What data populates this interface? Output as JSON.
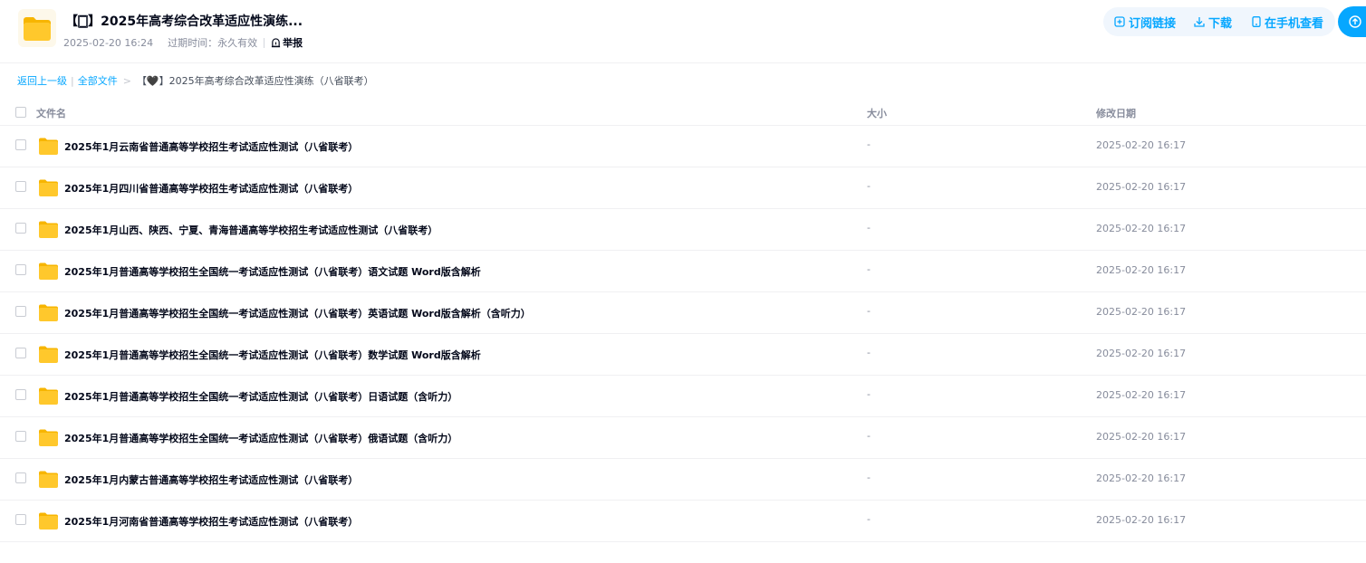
{
  "share": {
    "title": "【🀆】2025年高考综合改革适应性演练...",
    "date": "2025-02-20 16:24",
    "expire_label": "过期时间：",
    "expire_value": "永久有效",
    "report_label": "举报"
  },
  "actions": {
    "subscribe": "订阅链接",
    "download": "下载",
    "mobile": "在手机查看"
  },
  "breadcrumb": {
    "back": "返回上一级",
    "all_files": "全部文件",
    "arrow": ">",
    "current": "【🖤】2025年高考综合改革适应性演练（八省联考）"
  },
  "table": {
    "headers": {
      "name": "文件名",
      "size": "大小",
      "date": "修改日期"
    },
    "rows": [
      {
        "name": "2025年1月云南省普通高等学校招生考试适应性测试（八省联考）",
        "size": "-",
        "date": "2025-02-20 16:17"
      },
      {
        "name": "2025年1月四川省普通高等学校招生考试适应性测试（八省联考）",
        "size": "-",
        "date": "2025-02-20 16:17"
      },
      {
        "name": "2025年1月山西、陕西、宁夏、青海普通高等学校招生考试适应性测试（八省联考）",
        "size": "-",
        "date": "2025-02-20 16:17"
      },
      {
        "name": "2025年1月普通高等学校招生全国统一考试适应性测试（八省联考）语文试题 Word版含解析",
        "size": "-",
        "date": "2025-02-20 16:17"
      },
      {
        "name": "2025年1月普通高等学校招生全国统一考试适应性测试（八省联考）英语试题 Word版含解析（含听力）",
        "size": "-",
        "date": "2025-02-20 16:17"
      },
      {
        "name": "2025年1月普通高等学校招生全国统一考试适应性测试（八省联考）数学试题 Word版含解析",
        "size": "-",
        "date": "2025-02-20 16:17"
      },
      {
        "name": "2025年1月普通高等学校招生全国统一考试适应性测试（八省联考）日语试题（含听力）",
        "size": "-",
        "date": "2025-02-20 16:17"
      },
      {
        "name": "2025年1月普通高等学校招生全国统一考试适应性测试（八省联考）俄语试题（含听力）",
        "size": "-",
        "date": "2025-02-20 16:17"
      },
      {
        "name": "2025年1月内蒙古普通高等学校招生考试适应性测试（八省联考）",
        "size": "-",
        "date": "2025-02-20 16:17"
      },
      {
        "name": "2025年1月河南省普通高等学校招生考试适应性测试（八省联考）",
        "size": "-",
        "date": "2025-02-20 16:17"
      }
    ]
  },
  "colors": {
    "accent": "#06a7ff",
    "folder": "#ffc82c",
    "text": "#03081a",
    "muted": "#878c9c"
  }
}
